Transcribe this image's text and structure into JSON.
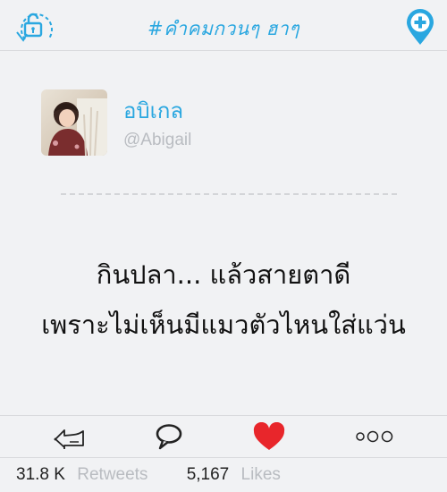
{
  "header": {
    "hashtag": "#คำคมกวนๆ ฮาๆ",
    "lock_icon": "unlock-icon",
    "add_icon": "add-location-icon"
  },
  "profile": {
    "display_name": "อบิเกล",
    "handle": "@Abigail"
  },
  "post": {
    "lines": [
      "กินปลา... แล้วสายตาดี",
      "เพราะไม่เห็นมีแมวตัวไหนใส่แว่น"
    ]
  },
  "actions": {
    "retweet_icon": "retweet-icon",
    "comment_icon": "comment-icon",
    "like_icon": "heart-icon",
    "more_icon": "more-icon"
  },
  "stats": {
    "retweets_count": "31.8 K",
    "retweets_label": "Retweets",
    "likes_count": "5,167",
    "likes_label": "Likes"
  },
  "colors": {
    "accent": "#2aa7e0",
    "like": "#e8262b",
    "background": "#f1f2f4"
  }
}
